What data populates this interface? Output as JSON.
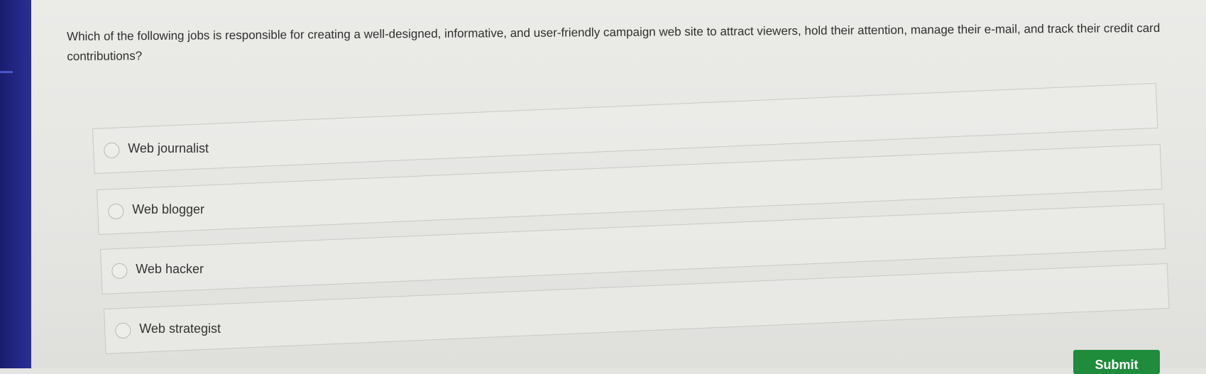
{
  "question": {
    "text": "Which of the following jobs is responsible for creating a well-designed, informative, and user-friendly campaign web site to attract viewers, hold their attention, manage their e-mail, and track their credit card contributions?"
  },
  "options": [
    {
      "label": "Web journalist"
    },
    {
      "label": "Web blogger"
    },
    {
      "label": "Web hacker"
    },
    {
      "label": "Web strategist"
    }
  ],
  "actions": {
    "submit_label": "Submit"
  },
  "colors": {
    "submit_bg": "#1e8c3a",
    "sidebar": "#242a8a"
  }
}
